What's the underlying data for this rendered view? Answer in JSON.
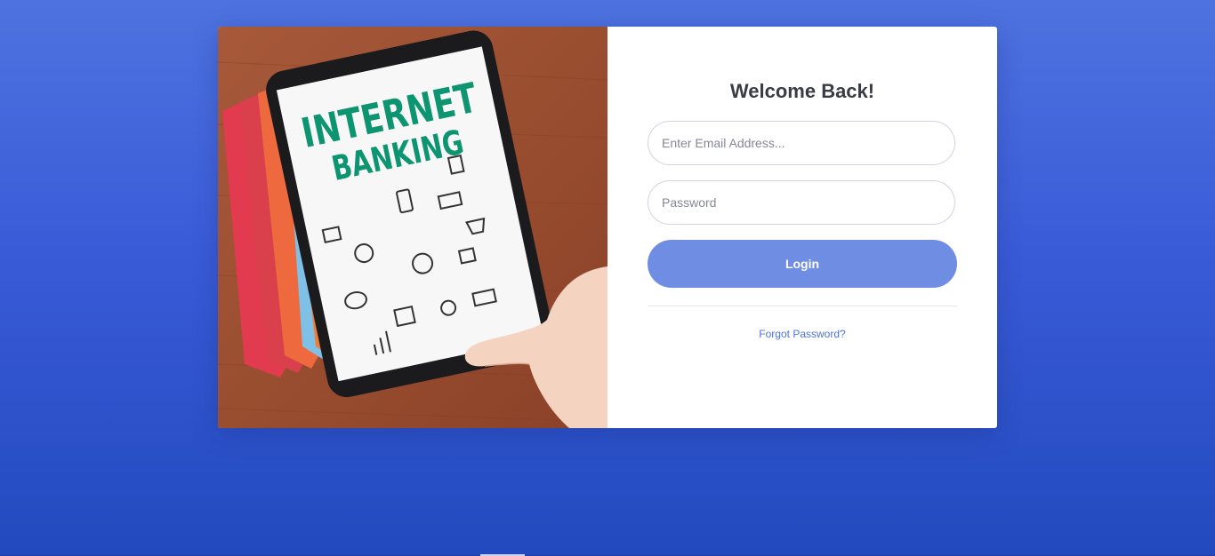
{
  "login": {
    "title": "Welcome Back!",
    "email": {
      "placeholder": "Enter Email Address...",
      "value": ""
    },
    "password": {
      "placeholder": "Password",
      "value": ""
    },
    "login_label": "Login",
    "forgot_label": "Forgot Password?"
  },
  "hero": {
    "line1": "INTERNET",
    "line2": "BANKING",
    "text_color": "#0d9470"
  },
  "colors": {
    "background_top": "#4e73df",
    "background_bottom": "#224abe",
    "button": "#6f8de3",
    "link": "#4e73df",
    "title": "#3a3b45"
  }
}
